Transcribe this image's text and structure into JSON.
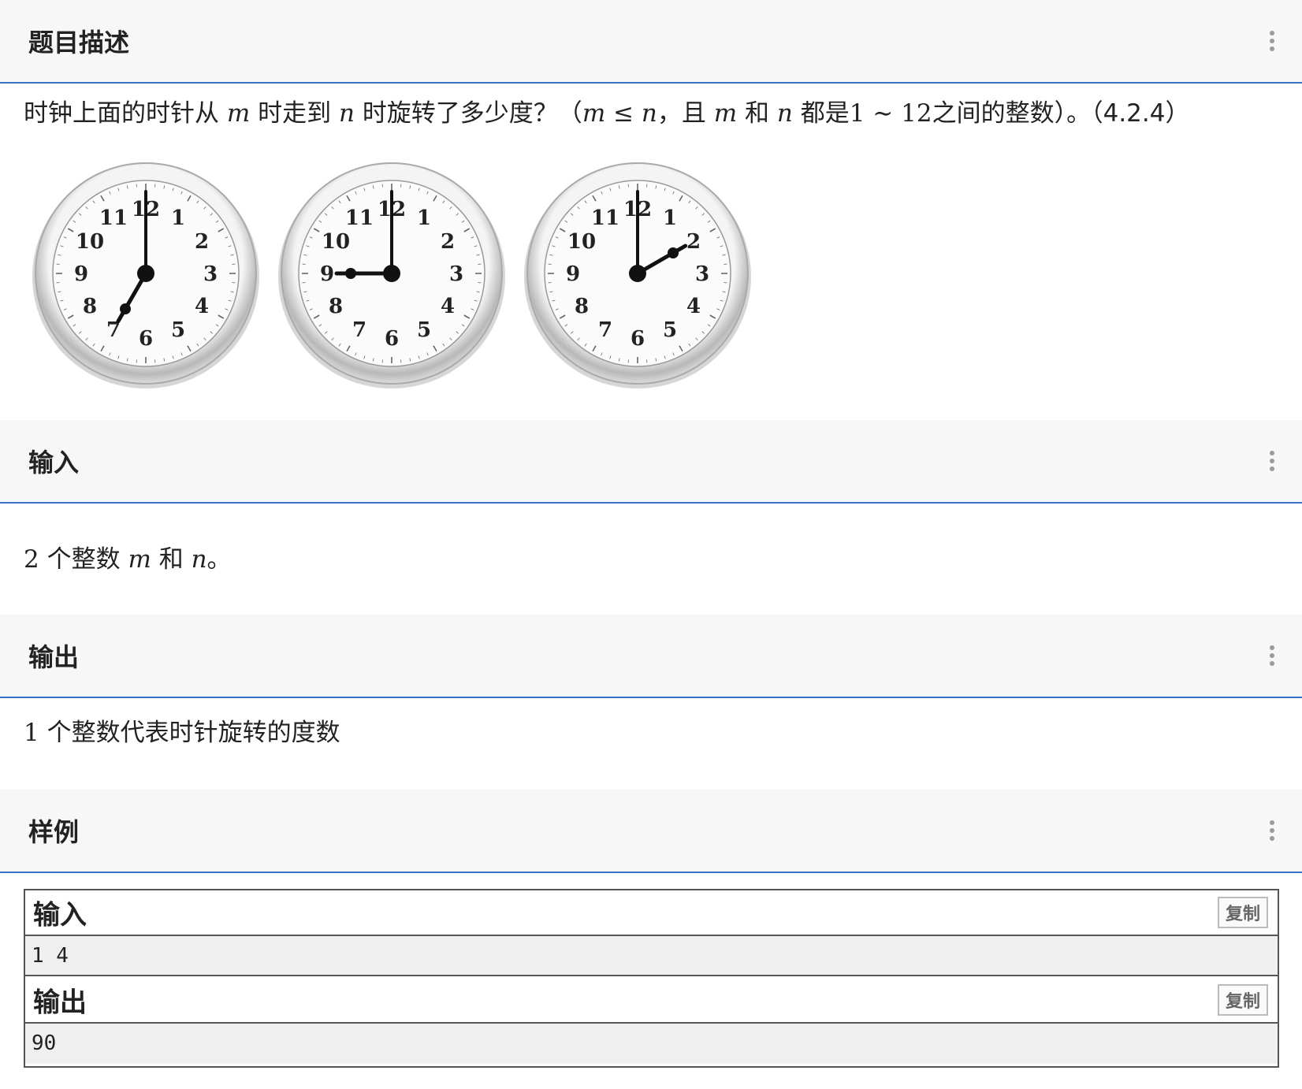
{
  "description": {
    "title": "题目描述",
    "text_a": "时钟上面的时针从",
    "var_m": "m",
    "text_b": "时走到",
    "var_n": "n",
    "text_c": "时旋转了多少度？（",
    "le": "≤",
    "comma": "，",
    "text_d": "且",
    "text_e": "和",
    "text_f": "都是",
    "num_1": "1",
    "tilde": "∼",
    "num_12": "12",
    "text_g": "之间的整数）。（4.2.4）",
    "clocks": [
      {
        "hour_hand_hour": 7,
        "minute_hand_minute": 0
      },
      {
        "hour_hand_hour": 9,
        "minute_hand_minute": 0
      },
      {
        "hour_hand_hour": 2,
        "minute_hand_minute": 0
      }
    ],
    "clock_numerals": [
      "12",
      "1",
      "2",
      "3",
      "4",
      "5",
      "6",
      "7",
      "8",
      "9",
      "10",
      "11"
    ]
  },
  "input": {
    "title": "输入",
    "count": "2",
    "text_a": "个整数",
    "var_m": "m",
    "text_b": "和",
    "var_n": "n",
    "text_c": "。"
  },
  "output": {
    "title": "输出",
    "count": "1",
    "text_a": "个整数代表时针旋转的度数"
  },
  "sample": {
    "title": "样例",
    "input_label": "输入",
    "input_value": "1 4",
    "output_label": "输出",
    "output_value": "90",
    "copy_label": "复制"
  },
  "colors": {
    "accent_border": "#3b73c9",
    "header_bg": "#f7f7f7"
  }
}
